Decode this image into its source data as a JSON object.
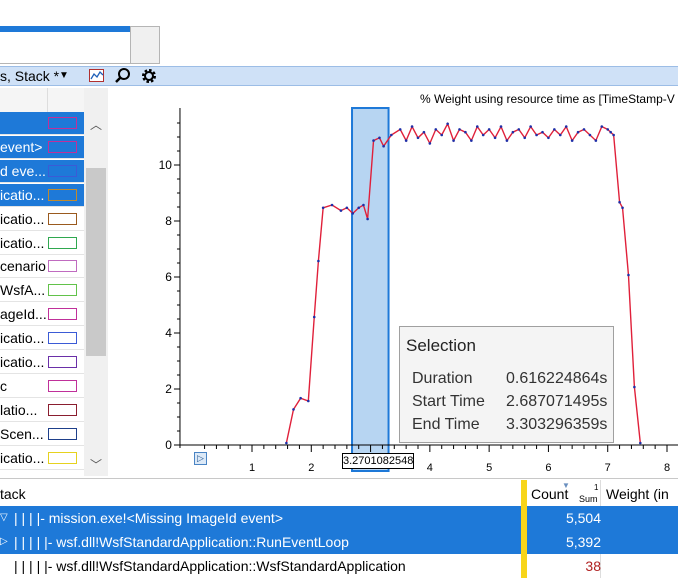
{
  "toolbar": {
    "group_label": "s, Stack *",
    "icons": [
      "chart-icon",
      "search-icon",
      "gear-icon"
    ]
  },
  "left_rows": [
    {
      "text": "",
      "selected": true,
      "color": "#c0309a"
    },
    {
      "text": "event>",
      "selected": true,
      "color": "#c0309a"
    },
    {
      "text": "d eve...",
      "selected": true,
      "color": "#3b5bd6"
    },
    {
      "text": "icatio...",
      "selected": true,
      "color": "#c08a2f"
    },
    {
      "text": "icatio...",
      "selected": false,
      "color": "#9a5a1e"
    },
    {
      "text": "icatio...",
      "selected": false,
      "color": "#2fa84f"
    },
    {
      "text": "cenario",
      "selected": false,
      "color": "#c06bc0"
    },
    {
      "text": "WsfA...",
      "selected": false,
      "color": "#62c24a"
    },
    {
      "text": "ageId...",
      "selected": false,
      "color": "#c0309a"
    },
    {
      "text": "icatio...",
      "selected": false,
      "color": "#3b5bd6"
    },
    {
      "text": "icatio...",
      "selected": false,
      "color": "#6a2fa8"
    },
    {
      "text": "c",
      "selected": false,
      "color": "#c0309a"
    },
    {
      "text": "latio...",
      "selected": false,
      "color": "#8a1e2f"
    },
    {
      "text": "Scen...",
      "selected": false,
      "color": "#1e3f8a"
    },
    {
      "text": "icatio...",
      "selected": false,
      "color": "#e6d21e"
    }
  ],
  "chart_data": {
    "type": "line",
    "title": "% Weight using resource time as [TimeStamp-V",
    "xlim": [
      0,
      8.3
    ],
    "ylim": [
      0,
      12
    ],
    "xticks": [
      "1",
      "2",
      "3",
      "4",
      "5",
      "6",
      "7",
      "8"
    ],
    "yticks": [
      "0",
      "2",
      "4",
      "6",
      "8",
      "10"
    ],
    "series": [
      {
        "color": "#e0203a",
        "marker_color": "#1e2fa8",
        "x": [
          1.58,
          1.7,
          1.82,
          1.95,
          2.05,
          2.12,
          2.2,
          2.35,
          2.5,
          2.6,
          2.7,
          2.8,
          2.88,
          2.95,
          3.05,
          3.15,
          3.22,
          3.35,
          3.5,
          3.6,
          3.7,
          3.8,
          3.9,
          4.0,
          4.1,
          4.2,
          4.3,
          4.4,
          4.5,
          4.6,
          4.7,
          4.8,
          4.9,
          5.0,
          5.1,
          5.2,
          5.3,
          5.4,
          5.5,
          5.6,
          5.7,
          5.8,
          5.9,
          6.0,
          6.1,
          6.2,
          6.3,
          6.4,
          6.5,
          6.6,
          6.7,
          6.8,
          6.9,
          7.0,
          7.05,
          7.1,
          7.2,
          7.25,
          7.35,
          7.45,
          7.55
        ],
        "y": [
          0.0,
          1.2,
          1.6,
          1.5,
          4.5,
          6.5,
          8.4,
          8.5,
          8.3,
          8.4,
          8.2,
          8.4,
          8.5,
          8.0,
          10.8,
          10.9,
          10.6,
          11.0,
          11.2,
          10.8,
          11.3,
          10.9,
          11.1,
          10.7,
          11.2,
          11.0,
          11.4,
          10.8,
          11.2,
          11.1,
          10.8,
          11.3,
          11.0,
          11.2,
          10.9,
          11.3,
          10.8,
          11.1,
          11.2,
          10.9,
          11.3,
          11.0,
          11.1,
          10.9,
          11.2,
          11.0,
          11.3,
          10.8,
          11.1,
          11.2,
          11.0,
          10.8,
          11.3,
          11.2,
          11.1,
          11.0,
          8.6,
          8.4,
          6.0,
          2.0,
          0.0
        ]
      }
    ],
    "selection": {
      "start": 2.687071495,
      "end": 3.303296359
    },
    "selection_label": "3.2701082548",
    "legend": "none",
    "grid": false
  },
  "tooltip": {
    "title": "Selection",
    "rows": [
      {
        "label": "Duration",
        "value": "0.616224864s"
      },
      {
        "label": "Start Time",
        "value": "2.687071495s"
      },
      {
        "label": "End Time",
        "value": "3.303296359s"
      }
    ]
  },
  "bottom_table": {
    "headers": {
      "stack": "tack",
      "count": "Count",
      "count_sub": "Sum",
      "count_sort": "1",
      "weight": "Weight (in"
    },
    "rows": [
      {
        "text": "|  |  |  |- mission.exe!<Missing ImageId event>",
        "count": "5,504",
        "selected": true
      },
      {
        "text": "|  |  |  |  |- wsf.dll!WsfStandardApplication::RunEventLoop",
        "count": "5,392",
        "selected": true
      },
      {
        "text": "|  |  |  |  |- wsf.dll!WsfStandardApplication::WsfStandardApplication",
        "count": "38",
        "selected": false
      }
    ]
  }
}
